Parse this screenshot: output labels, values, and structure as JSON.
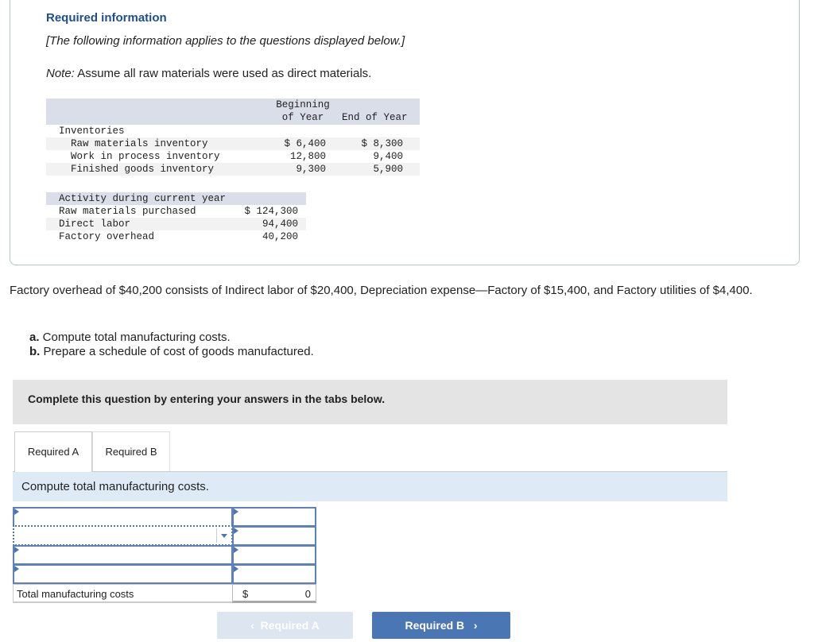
{
  "info": {
    "heading": "Required information",
    "subheading": "[The following information applies to the questions displayed below.]",
    "note_label": "Note:",
    "note_text": " Assume all raw materials were used as direct materials."
  },
  "inventory_table": {
    "col1": "Beginning",
    "col1b": "of Year",
    "col2": "End of Year",
    "section": "Inventories",
    "rows": [
      {
        "label": "Raw materials inventory",
        "begin": "$ 6,400",
        "end": "$ 8,300"
      },
      {
        "label": "Work in process inventory",
        "begin": "12,800",
        "end": "9,400"
      },
      {
        "label": "Finished goods inventory",
        "begin": "9,300",
        "end": "5,900"
      }
    ]
  },
  "activity_table": {
    "header": "Activity during current year",
    "rows": [
      {
        "label": "Raw materials purchased",
        "value": "$ 124,300"
      },
      {
        "label": "Direct labor",
        "value": "94,400"
      },
      {
        "label": "Factory overhead",
        "value": "40,200"
      }
    ]
  },
  "overhead_text": "Factory overhead of $40,200 consists of Indirect labor of $20,400, Depreciation expense—Factory of $15,400, and Factory utilities of $4,400.",
  "tasks": [
    {
      "letter": "a.",
      "text": " Compute total manufacturing costs."
    },
    {
      "letter": "b.",
      "text": " Prepare a schedule of cost of goods manufactured."
    }
  ],
  "instruction": "Complete this question by entering your answers in the tabs below.",
  "tabs": [
    {
      "label": "Required A",
      "active": true
    },
    {
      "label": "Required B",
      "active": false
    }
  ],
  "panel_title": "Compute total manufacturing costs.",
  "answer_table": {
    "total_label": "Total manufacturing costs",
    "currency": "$",
    "total_value": "0"
  },
  "nav": {
    "prev": "Required A",
    "next": "Required B"
  },
  "colors": {
    "accent": "#4a76b4",
    "heading": "#1f4e8c"
  }
}
